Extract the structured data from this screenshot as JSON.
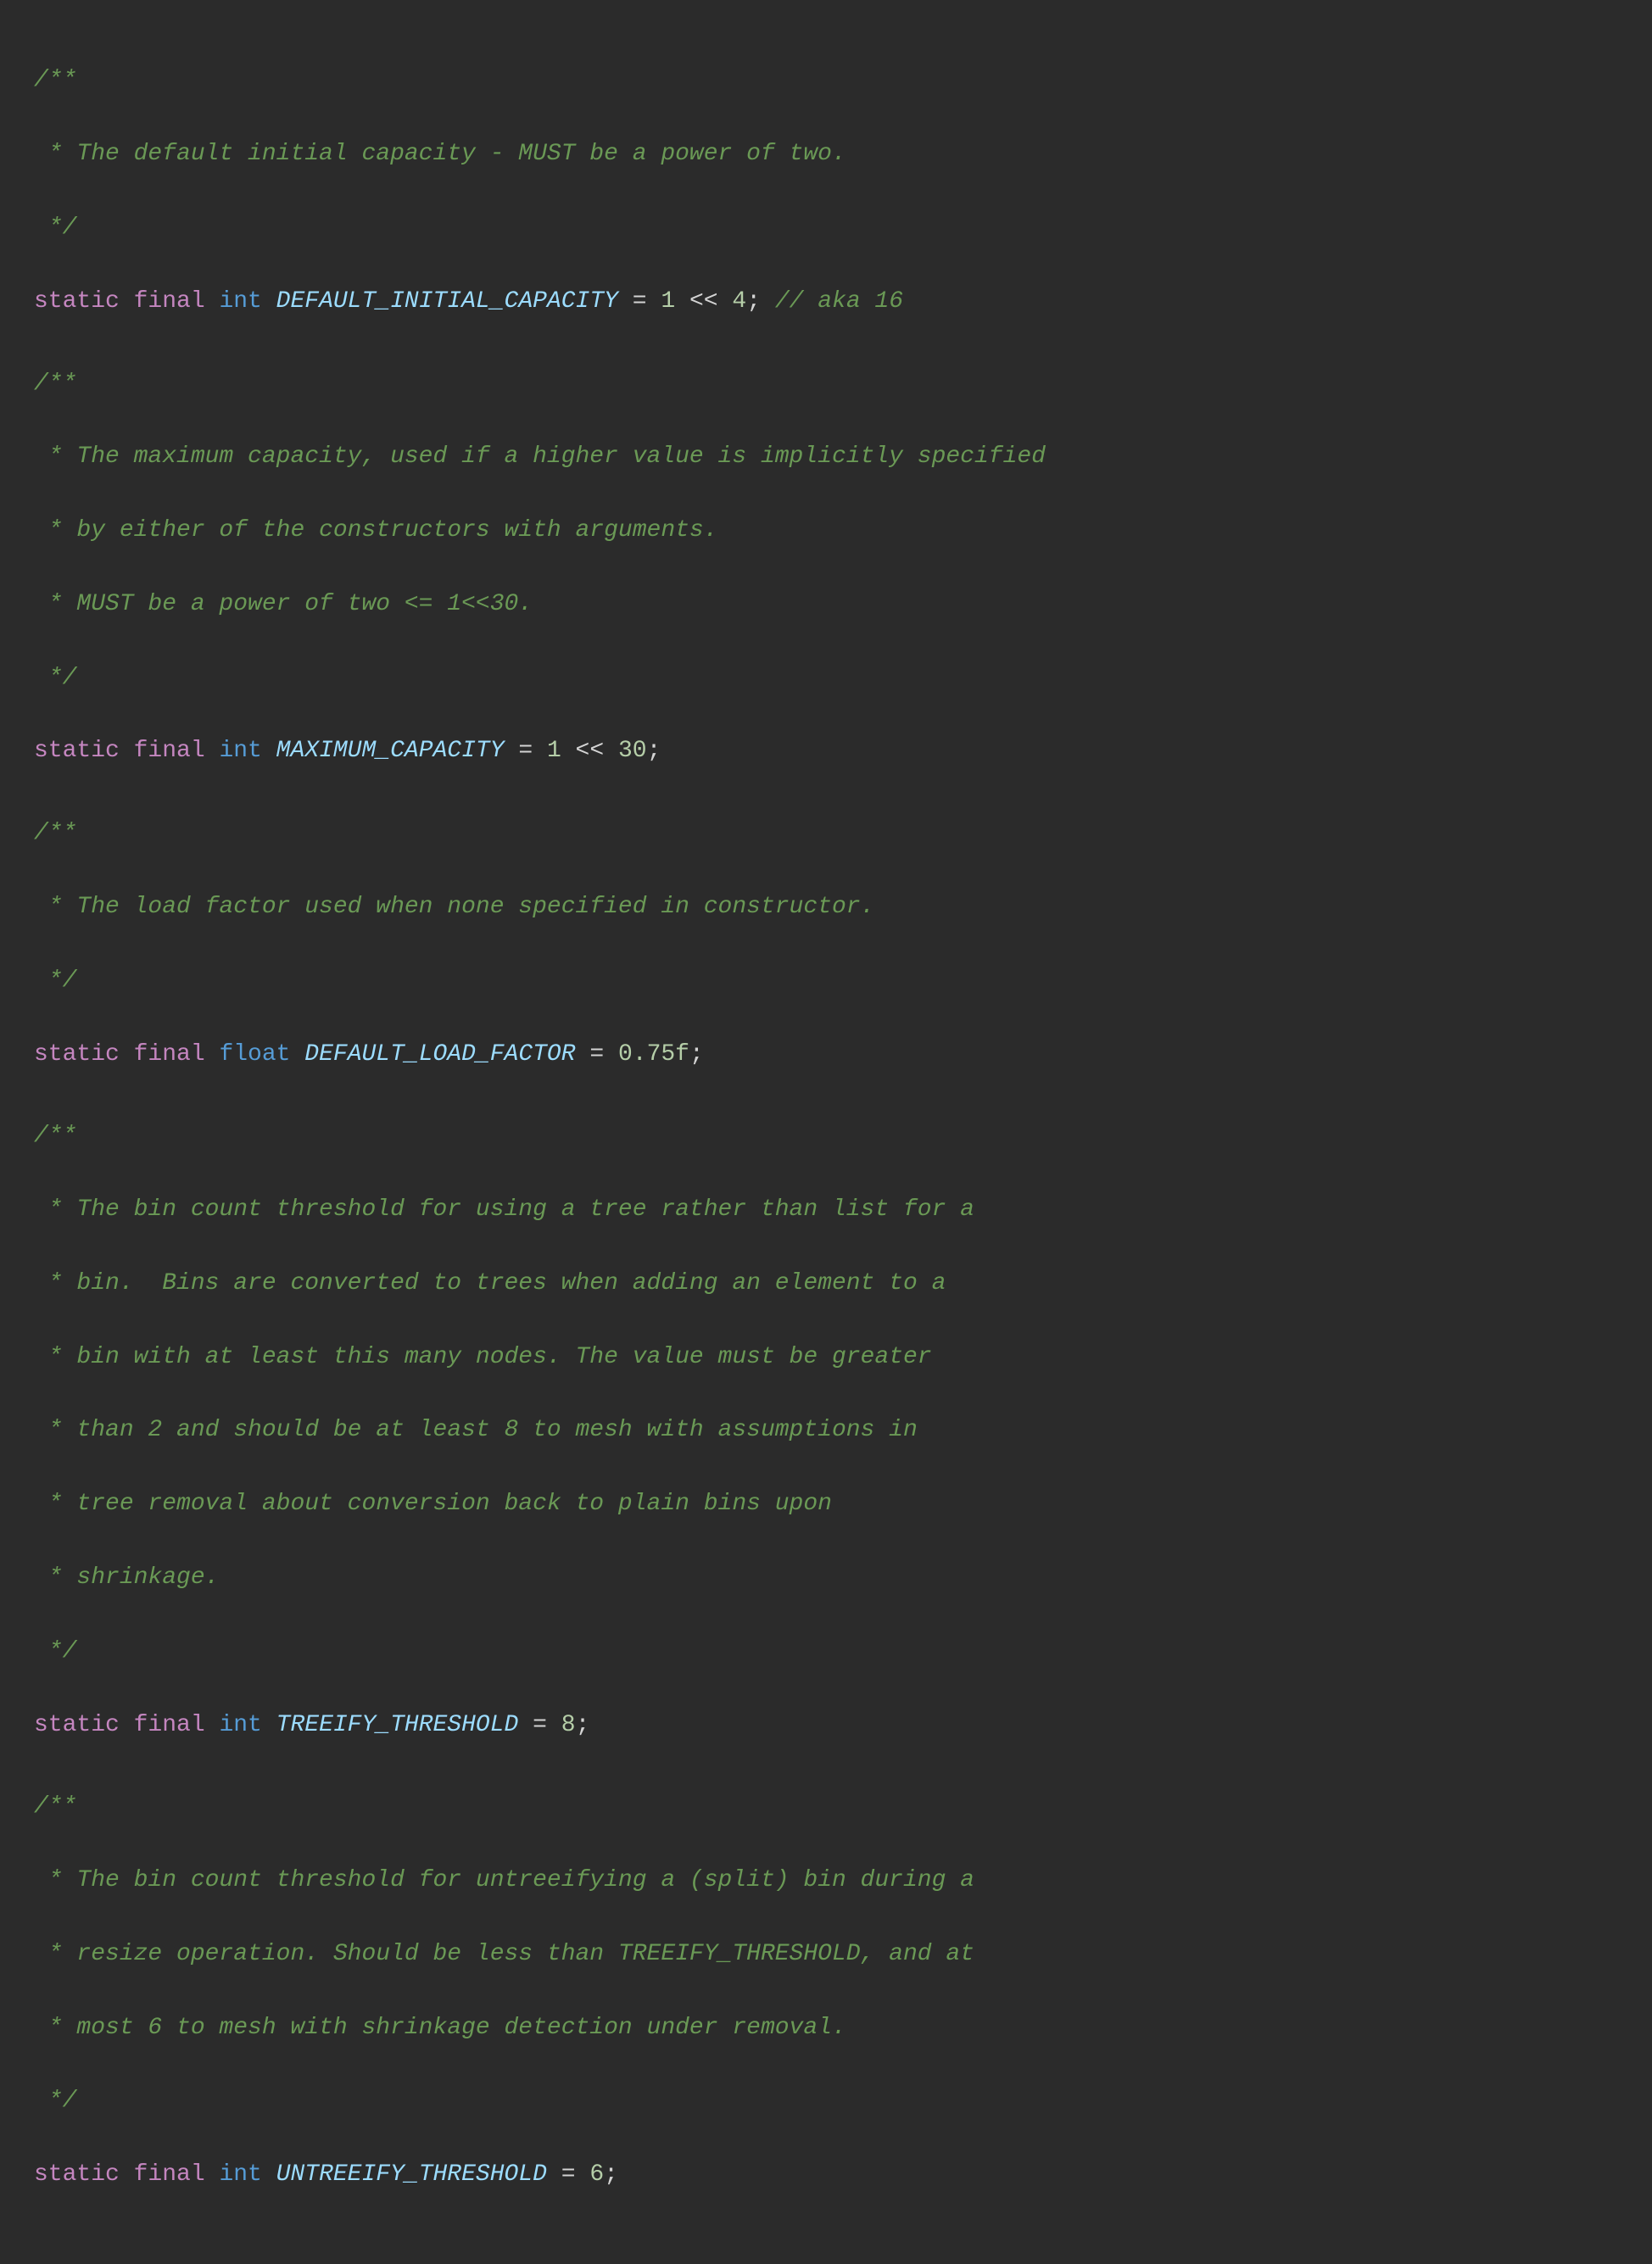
{
  "code": {
    "sections": [
      {
        "id": "section1",
        "comment_lines": [
          "/**",
          " * The default initial capacity - MUST be a power of two.",
          " */"
        ],
        "code_line": {
          "parts": [
            {
              "text": "static ",
              "class": "keyword"
            },
            {
              "text": "final ",
              "class": "keyword"
            },
            {
              "text": "int ",
              "class": "type"
            },
            {
              "text": "DEFAULT_INITIAL_CAPACITY",
              "class": "identifier"
            },
            {
              "text": " = ",
              "class": "plain"
            },
            {
              "text": "1",
              "class": "number"
            },
            {
              "text": " << ",
              "class": "plain"
            },
            {
              "text": "4",
              "class": "number"
            },
            {
              "text": "; ",
              "class": "plain"
            },
            {
              "text": "// aka 16",
              "class": "comment"
            }
          ]
        }
      },
      {
        "id": "section2",
        "comment_lines": [
          "/**",
          " * The maximum capacity, used if a higher value is implicitly specified",
          " * by either of the constructors with arguments.",
          " * MUST be a power of two <= 1<<30.",
          " */"
        ],
        "code_line": {
          "parts": [
            {
              "text": "static ",
              "class": "keyword"
            },
            {
              "text": "final ",
              "class": "keyword"
            },
            {
              "text": "int ",
              "class": "type"
            },
            {
              "text": "MAXIMUM_CAPACITY",
              "class": "identifier"
            },
            {
              "text": " = ",
              "class": "plain"
            },
            {
              "text": "1",
              "class": "number"
            },
            {
              "text": " << ",
              "class": "plain"
            },
            {
              "text": "30",
              "class": "number"
            },
            {
              "text": ";",
              "class": "plain"
            }
          ]
        }
      },
      {
        "id": "section3",
        "comment_lines": [
          "/**",
          " * The load factor used when none specified in constructor.",
          " */"
        ],
        "code_line": {
          "parts": [
            {
              "text": "static ",
              "class": "keyword"
            },
            {
              "text": "final ",
              "class": "keyword"
            },
            {
              "text": "float ",
              "class": "type"
            },
            {
              "text": "DEFAULT_LOAD_FACTOR",
              "class": "identifier"
            },
            {
              "text": " = ",
              "class": "plain"
            },
            {
              "text": "0.75f",
              "class": "number"
            },
            {
              "text": ";",
              "class": "plain"
            }
          ]
        }
      },
      {
        "id": "section4",
        "comment_lines": [
          "/**",
          " * The bin count threshold for using a tree rather than list for a",
          " * bin.  Bins are converted to trees when adding an element to a",
          " * bin with at least this many nodes. The value must be greater",
          " * than 2 and should be at least 8 to mesh with assumptions in",
          " * tree removal about conversion back to plain bins upon",
          " * shrinkage.",
          " */"
        ],
        "code_line": {
          "parts": [
            {
              "text": "static ",
              "class": "keyword"
            },
            {
              "text": "final ",
              "class": "keyword"
            },
            {
              "text": "int ",
              "class": "type"
            },
            {
              "text": "TREEIFY_THRESHOLD",
              "class": "identifier"
            },
            {
              "text": " = ",
              "class": "plain"
            },
            {
              "text": "8",
              "class": "number"
            },
            {
              "text": ";",
              "class": "plain"
            }
          ]
        }
      },
      {
        "id": "section5",
        "comment_lines": [
          "/**",
          " * The bin count threshold for untreeifying a (split) bin during a",
          " * resize operation. Should be less than TREEIFY_THRESHOLD, and at",
          " * most 6 to mesh with shrinkage detection under removal.",
          " */"
        ],
        "code_line": {
          "parts": [
            {
              "text": "static ",
              "class": "keyword"
            },
            {
              "text": "final ",
              "class": "keyword"
            },
            {
              "text": "int ",
              "class": "type"
            },
            {
              "text": "UNTREEIFY_THRESHOLD",
              "class": "identifier"
            },
            {
              "text": " = ",
              "class": "plain"
            },
            {
              "text": "6",
              "class": "number"
            },
            {
              "text": ";",
              "class": "plain"
            }
          ]
        }
      }
    ]
  }
}
